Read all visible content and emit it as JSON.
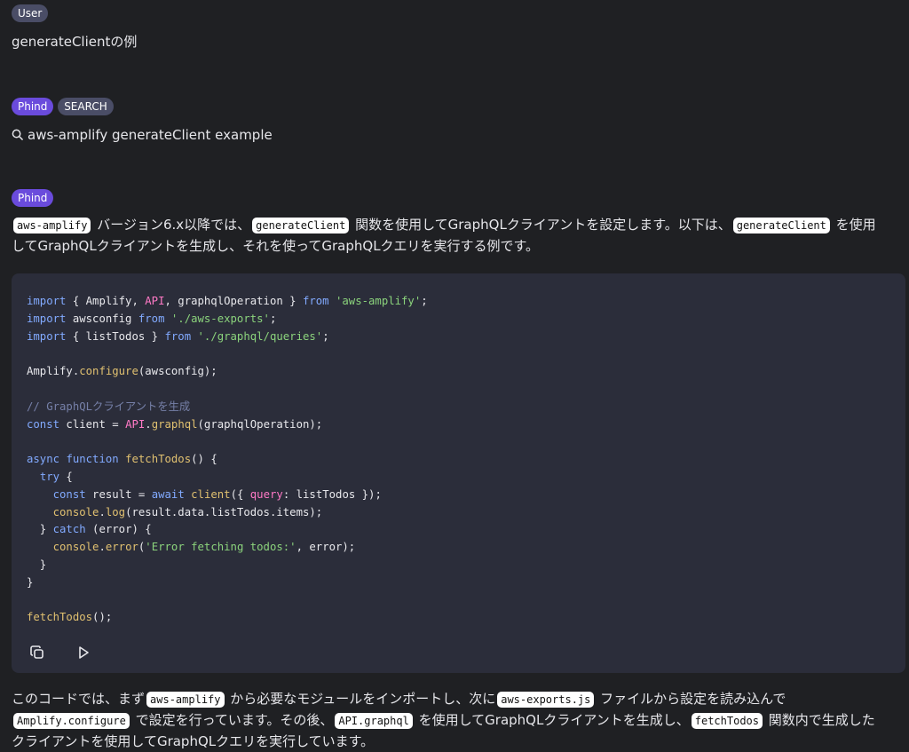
{
  "user": {
    "badge": "User",
    "message": "generateClientの例"
  },
  "search": {
    "badges": [
      "Phind",
      "SEARCH"
    ],
    "query": "aws-amplify generateClient example",
    "icon": "search-icon"
  },
  "answer": {
    "badge": "Phind",
    "intro": {
      "code1": "aws-amplify",
      "t1": " バージョン6.x以降では、",
      "code2": "generateClient",
      "t2": " 関数を使用してGraphQLクライアントを設定します。以下は、",
      "code3": "generateClient",
      "t3": " を使用してGraphQLクライアントを生成し、それを使ってGraphQLクエリを実行する例です。"
    },
    "code_lines": [
      "import { Amplify, API, graphqlOperation } from 'aws-amplify';",
      "import awsconfig from './aws-exports';",
      "import { listTodos } from './graphql/queries';",
      "",
      "Amplify.configure(awsconfig);",
      "",
      "// GraphQLクライアントを生成",
      "const client = API.graphql(graphqlOperation);",
      "",
      "async function fetchTodos() {",
      "  try {",
      "    const result = await client({ query: listTodos });",
      "    console.log(result.data.listTodos.items);",
      "  } catch (error) {",
      "    console.error('Error fetching todos:', error);",
      "  }",
      "}",
      "",
      "fetchTodos();"
    ],
    "actions": [
      "copy-icon",
      "play-icon"
    ],
    "outro": {
      "t1": "このコードでは、まず",
      "code1": "aws-amplify",
      "t2": " から必要なモジュールをインポートし、次に",
      "code2": "aws-exports.js",
      "t3": " ファイルから設定を読み込んで",
      "code3": "Amplify.configure",
      "t4": " で設定を行っています。その後、",
      "code4": "API.graphql",
      "t5": " を使用してGraphQLクライアントを生成し、",
      "code5": "fetchTodos",
      "t6": " 関数内で生成したクライアントを使用してGraphQLクエリを実行しています。"
    }
  }
}
